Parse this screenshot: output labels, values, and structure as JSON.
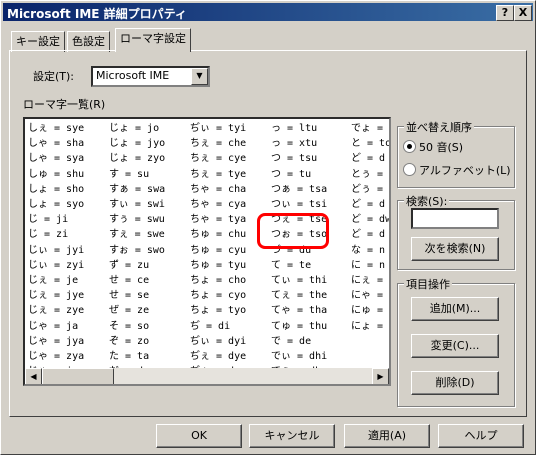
{
  "window": {
    "title": "Microsoft IME 詳細プロパティ",
    "help_btn": "?",
    "close_btn": "X"
  },
  "tabs": [
    "キー設定",
    "色設定",
    "ローマ字設定"
  ],
  "settings": {
    "label": "設定(T):",
    "value": "Microsoft IME"
  },
  "list_title": "ローマ字一覧(R)",
  "columns": [
    [
      "しぇ = sye",
      "しゃ = sha",
      "しゃ = sya",
      "しゅ = shu",
      "しょ = sho",
      "しょ = syo",
      "じ = ji",
      "じ = zi",
      "じぃ = jyi",
      "じぃ = zyi",
      "じぇ = je",
      "じぇ = jye",
      "じぇ = zye",
      "じゃ = ja",
      "じゃ = jya",
      "じゃ = zya",
      "じゅ = ju",
      "じゅ = jyu",
      "じゅ = zyu"
    ],
    [
      "じょ = jo",
      "じょ = jyo",
      "じょ = zyo",
      "す = su",
      "すぁ = swa",
      "すぃ = swi",
      "すぅ = swu",
      "すぇ = swe",
      "すぉ = swo",
      "ず = zu",
      "せ = ce",
      "せ = se",
      "ぜ = ze",
      "そ = so",
      "ぞ = zo",
      "た = ta",
      "だ = da",
      "ち = chi",
      "ち = ti",
      "ちぃ = cyi"
    ],
    [
      "ぢぃ = tyi",
      "ちぇ = che",
      "ちぇ = cye",
      "ちぇ = tye",
      "ちゃ = cha",
      "ちゃ = cya",
      "ちゃ = tya",
      "ちゅ = chu",
      "ちゅ = cyu",
      "ちゅ = tyu",
      "ちょ = cho",
      "ちょ = cyo",
      "ちょ = tyo",
      "ぢ = di",
      "ぢぃ = dyi",
      "ぢぇ = dye",
      "ぢゃ = dya",
      "ぢゅ = dyu",
      "ぢょ = dyo",
      "っ = ltsu"
    ],
    [
      "っ = ltu",
      "っ = xtu",
      "つ = tsu",
      "つ = tu",
      "つぁ = tsa",
      "つぃ = tsi",
      "つぇ = tse",
      "つぉ = tso",
      "づ = du",
      "て = te",
      "てぃ = thi",
      "てぇ = the",
      "てゃ = tha",
      "てゅ = thu",
      "で = de",
      "でぃ = dhi",
      "でぇ = dhe",
      "でゃ = dha",
      "でゅ = dhu"
    ],
    [
      "でょ = d",
      "と = to",
      "ど = d",
      "とぅ = tw",
      "どぅ = d",
      "ど = d",
      "ど = dw",
      "ど = d",
      "な = n",
      "に = n",
      "にぇ = n",
      "にゃ = n",
      "にゅ = n",
      "にょ = n"
    ]
  ],
  "sort_group": {
    "title": "並べ替え順序",
    "option_50": "50 音(S)",
    "option_alpha": "アルファベット(L)"
  },
  "search_group": {
    "title": "検索(S):",
    "value": "",
    "button": "次を検索(N)"
  },
  "item_group": {
    "title": "項目操作",
    "add": "追加(M)...",
    "change": "変更(C)...",
    "delete": "削除(D)"
  },
  "footer": {
    "ok": "OK",
    "cancel": "キャンセル",
    "apply": "適用(A)",
    "help": "ヘルプ"
  },
  "colors": {
    "title_start": "#0a246a",
    "title_end": "#3a6ea5",
    "highlight": "#ff0000"
  }
}
